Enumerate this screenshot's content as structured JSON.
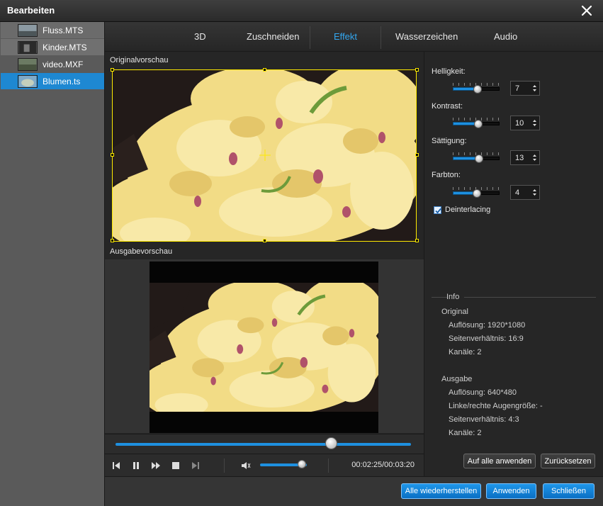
{
  "window": {
    "title": "Bearbeiten"
  },
  "files": [
    {
      "name": "Fluss.MTS",
      "selected": false
    },
    {
      "name": "Kinder.MTS",
      "selected": false
    },
    {
      "name": "video.MXF",
      "selected": false
    },
    {
      "name": "Blumen.ts",
      "selected": true
    }
  ],
  "tabs": {
    "items": [
      {
        "label": "3D"
      },
      {
        "label": "Zuschneiden"
      },
      {
        "label": "Effekt"
      },
      {
        "label": "Wasserzeichen"
      },
      {
        "label": "Audio"
      }
    ],
    "active": "Effekt"
  },
  "preview": {
    "original_label": "Originalvorschau",
    "output_label": "Ausgabevorschau"
  },
  "player": {
    "time": "00:02:25/00:03:20",
    "progress_fraction": 0.73,
    "volume_fraction": 0.9
  },
  "effects": {
    "brightness": {
      "label": "Helligkeit:",
      "value": "7"
    },
    "contrast": {
      "label": "Kontrast:",
      "value": "10"
    },
    "saturation": {
      "label": "Sättigung:",
      "value": "13"
    },
    "hue": {
      "label": "Farbton:",
      "value": "4"
    },
    "deinterlacing": {
      "label": "Deinterlacing",
      "checked": true
    }
  },
  "info": {
    "title": "Info",
    "original": {
      "heading": "Original",
      "resolution": "Auflösung: 1920*1080",
      "aspect": "Seitenverhältnis: 16:9",
      "channels": "Kanäle: 2"
    },
    "output": {
      "heading": "Ausgabe",
      "resolution": "Auflösung: 640*480",
      "eye_size": "Linke/rechte Augengröße: -",
      "aspect": "Seitenverhältnis: 4:3",
      "channels": "Kanäle: 2"
    }
  },
  "buttons": {
    "apply_all": "Auf alle anwenden",
    "reset": "Zurücksetzen",
    "restore_all": "Alle wiederherstellen",
    "apply": "Anwenden",
    "close": "Schließen"
  },
  "colors": {
    "accent": "#1e88d2",
    "crop_frame": "#ffea00"
  }
}
